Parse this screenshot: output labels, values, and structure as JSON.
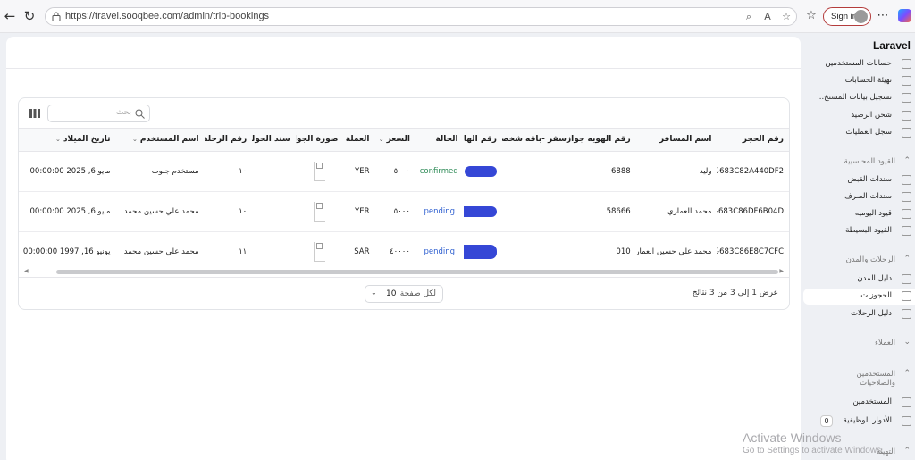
{
  "browser": {
    "url": "https://travel.sooqbee.com/admin/trip-bookings",
    "signin_label": "Sign in"
  },
  "table": {
    "search_placeholder": "بحث",
    "headers": {
      "booking_no": "رقم الحجز",
      "traveler": "اسم المسافر",
      "id_no": "رقم الهويه جوازسفر -باقه شخصيه-",
      "phone": "رقم الهاتف",
      "status": "الحالة",
      "price": "السعر",
      "currency": "العملة",
      "passport_img": "صورة الجواز",
      "transfer": "سند الحوله",
      "trip_no": "رقم الرحلة",
      "username": "اسم المستخدم",
      "birth_date": "تاريخ الميلاد"
    },
    "rows": [
      {
        "booking_no": "BK-683C82A440DF2",
        "traveler": "وليد",
        "id_no": "6888",
        "status": "confirmed",
        "price": "٥٠٠٠",
        "currency": "YER",
        "trip_no": "١٠",
        "username": "مستخدم جنوب",
        "birth_date": "مايو 6, 2025 00:00:00"
      },
      {
        "booking_no": "BK-683C86DF6B04D",
        "traveler": "محمد العماري",
        "id_no": "58666",
        "status": "pending",
        "price": "٥٠٠٠",
        "currency": "YER",
        "trip_no": "١٠",
        "username": "محمد علي حسين محمد",
        "birth_date": "مايو 6, 2025 00:00:00"
      },
      {
        "booking_no": "BK-683C86E8C7CFC",
        "traveler": "محمد علي حسين العماري",
        "id_no": "010",
        "status": "pending",
        "price": "٤٠٠٠٠",
        "currency": "SAR",
        "trip_no": "١١",
        "username": "محمد علي حسين محمد",
        "birth_date": "يونيو 16, 1997 00:00:00"
      }
    ],
    "per_page_value": "10",
    "per_page_label": "لكل صفحة",
    "results_text": "عرض 1 إلى 3 من 3 نتائج"
  },
  "sidebar": {
    "brand": "Laravel",
    "items_top": [
      "حسابات المستخدمين",
      "تهيئة الحسابات",
      "تسجيل بيانات المستخ...",
      "شحن الرصيد",
      "سجل العمليات"
    ],
    "group_accounting": "القيود المحاسبية",
    "items_accounting": [
      "سندات القبض",
      "سندات الصرف",
      "قيود اليوميه",
      "القيود البسيطة"
    ],
    "group_trips": "الرحلات والمدن",
    "items_trips": [
      "دليل المدن",
      "الحجوزات",
      "دليل الرحلات"
    ],
    "group_clients": "العملاء",
    "group_users": "المستخدمين والصلاحيات",
    "items_users": [
      "المستخدمين",
      "الأدوار الوظيفية"
    ],
    "roles_badge": "0",
    "group_setup": "التهيئة"
  },
  "watermark": {
    "line1": "Activate Windows",
    "line2": "Go to Settings to activate Windows."
  },
  "colors": {
    "redaction": "#3547d6",
    "confirmed": "#2e8b57",
    "pending": "#2e5fd0"
  }
}
